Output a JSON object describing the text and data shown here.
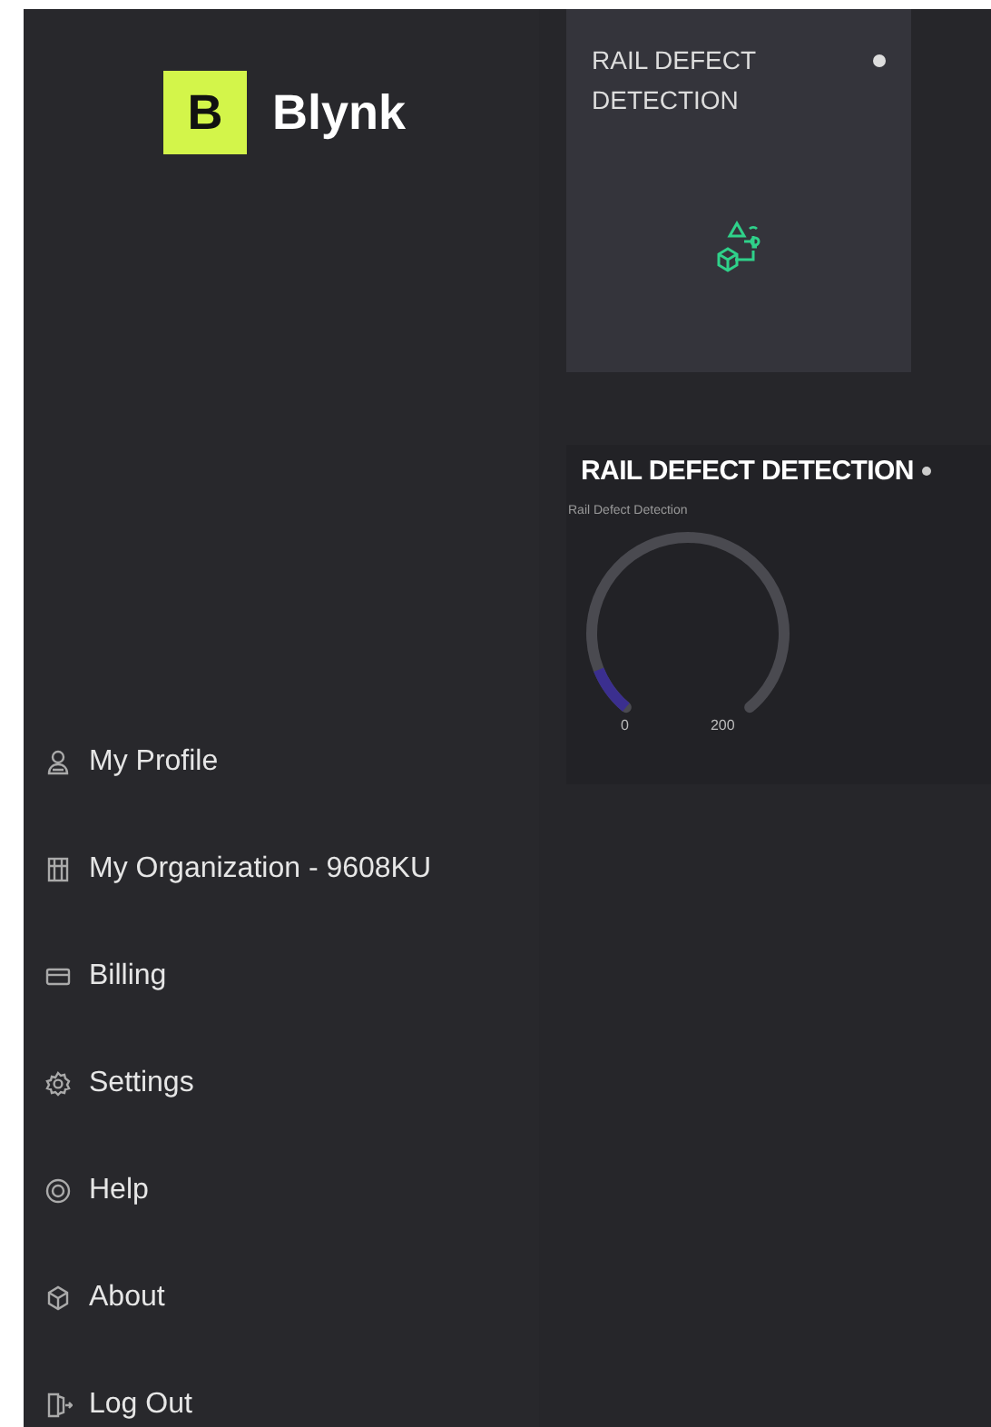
{
  "sidebar": {
    "logo": {
      "mark": "B",
      "name": "Blynk"
    },
    "menu": [
      {
        "label": "My Profile"
      },
      {
        "label": "My Organization - 9608KU"
      },
      {
        "label": "Billing"
      },
      {
        "label": "Settings"
      },
      {
        "label": "Help"
      },
      {
        "label": "About"
      },
      {
        "label": "Log Out"
      }
    ]
  },
  "widgets": [
    {
      "kind": "tile",
      "title": "RAIL DEFECT DETECTION"
    },
    {
      "kind": "gauge",
      "title": "RAIL DEFECT DETECTION",
      "label": "Rail Defect Detection",
      "min": "0",
      "max": "200"
    }
  ]
}
